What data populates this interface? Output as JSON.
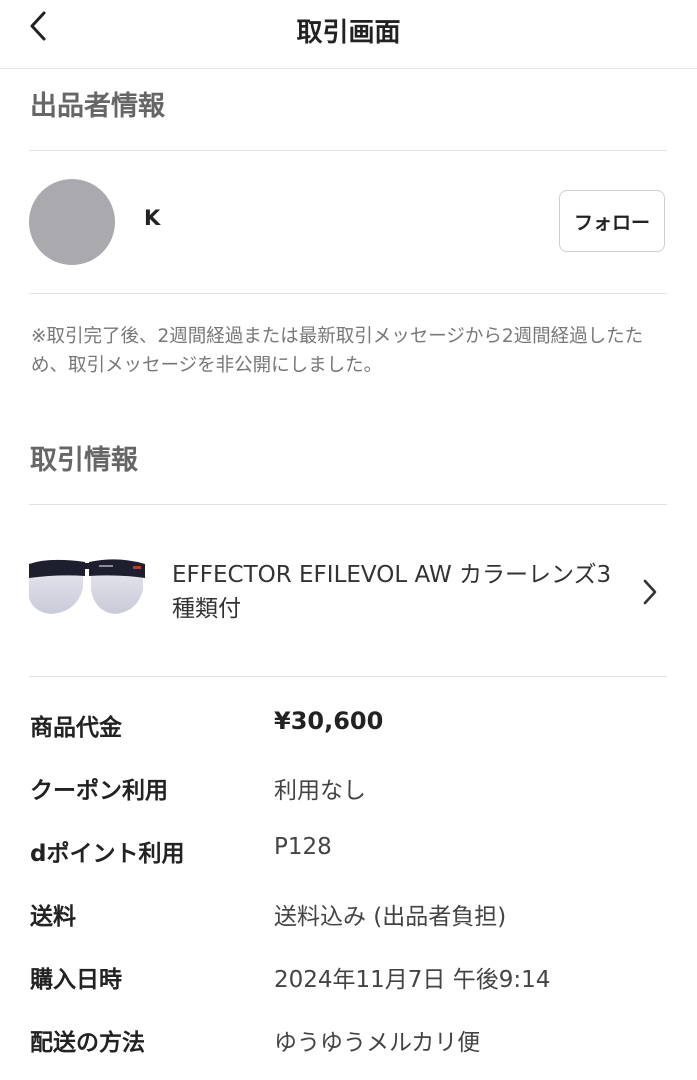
{
  "header": {
    "title": "取引画面",
    "back_icon": "chevron-left-icon"
  },
  "seller_section": {
    "title": "出品者情報",
    "seller_name": "K",
    "follow_label": "フォロー",
    "notice": "※取引完了後、2週間経過または最新取引メッセージから2週間経過したため、取引メッセージを非公開にしました。"
  },
  "transaction_section": {
    "title": "取引情報",
    "product": {
      "name": "EFFECTOR EFILEVOL AW カラーレンズ3種類付",
      "chevron_icon": "chevron-right-icon"
    },
    "details": [
      {
        "label": "商品代金",
        "value": "¥30,600"
      },
      {
        "label": "クーポン利用",
        "value": "利用なし"
      },
      {
        "label": "dポイント利用",
        "value": "P128"
      },
      {
        "label": "送料",
        "value": "送料込み (出品者負担)"
      },
      {
        "label": "購入日時",
        "value": "2024年11月7日 午後9:14"
      },
      {
        "label": "配送の方法",
        "value": "ゆうゆうメルカリ便"
      }
    ]
  },
  "colors": {
    "avatar": "#a9a9ae",
    "section_title": "#666666",
    "divider": "#e3e3e3"
  }
}
